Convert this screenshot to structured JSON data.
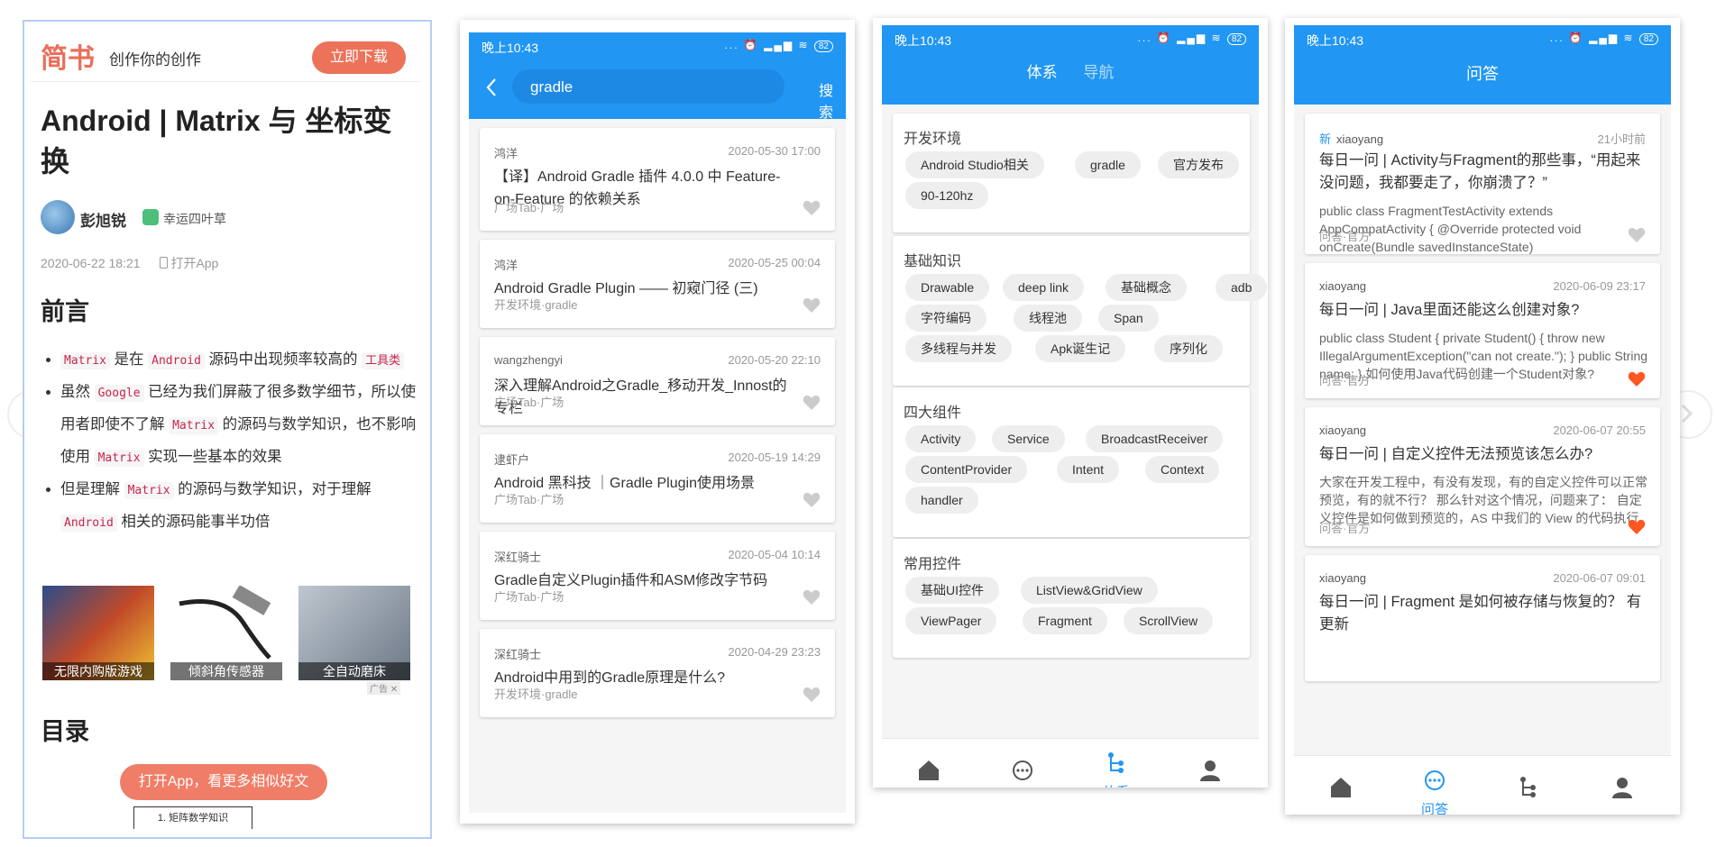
{
  "jianshu": {
    "logo": "简书",
    "slogan": "创作你的创作",
    "download_btn": "立即下载",
    "title": "Android | Matrix 与 坐标变换",
    "author": "彭旭锐",
    "badge": "幸运四叶草",
    "date": "2020-06-22 18:21",
    "open_app_meta": "打开App",
    "section_heading": "前言",
    "bullets": [
      [
        "Matrix",
        " 是在 ",
        "Android",
        " 源码中出现频率较高的 ",
        "工具类",
        ""
      ],
      [
        "",
        "虽然 ",
        "Google",
        " 已经为我们屏蔽了很多数学细节，所以使用者即使不了解 ",
        "Matrix",
        " 的源码与数学知识，也不影响使用 "
      ],
      [
        "",
        "但是理解 ",
        "Matrix",
        " 的源码与数学知识，对于理解 ",
        "Android",
        " 相关的源码能事半功倍"
      ]
    ],
    "bullet2_tail_code": "Matrix",
    "bullet2_tail_text": " 实现一些基本的效果",
    "ads": [
      "无限内购版游戏",
      "倾斜角传感器",
      "全自动磨床"
    ],
    "ad_mark": "广告 ✕",
    "toc_heading": "目录",
    "open_app_btn": "打开App，看更多相似好文",
    "toc_item": "1. 矩阵数学知识"
  },
  "status": {
    "time": "晚上10:43",
    "icons": "... ⏰ ▂▄▆ ≋",
    "battery": "82"
  },
  "search": {
    "query": "gradle",
    "button": "搜索",
    "results": [
      {
        "author": "鸿洋",
        "date": "2020-05-30 17:00",
        "title": "【译】Android Gradle 插件 4.0.0 中 Feature-on-Feature 的依赖关系",
        "tag": "广场Tab·广场"
      },
      {
        "author": "鸿洋",
        "date": "2020-05-25 00:04",
        "title": "Android Gradle Plugin —— 初窥门径 (三)",
        "tag": "开发环境·gradle"
      },
      {
        "author": "wangzhengyi",
        "date": "2020-05-20 22:10",
        "title": "深入理解Android之Gradle_移动开发_Innost的专栏",
        "tag": "广场Tab·广场"
      },
      {
        "author": "逮虾户",
        "date": "2020-05-19 14:29",
        "title": "Android 黑科技 ｜Gradle Plugin使用场景",
        "tag": "广场Tab·广场"
      },
      {
        "author": "深红骑士",
        "date": "2020-05-04 10:14",
        "title": "Gradle自定义Plugin插件和ASM修改字节码",
        "tag": "广场Tab·广场"
      },
      {
        "author": "深红骑士",
        "date": "2020-04-29 23:23",
        "title": "Android中用到的Gradle原理是什么?",
        "tag": "开发环境·gradle"
      }
    ]
  },
  "system": {
    "tabs": [
      "体系",
      "导航"
    ],
    "sections": [
      {
        "title": "开发环境",
        "chips": [
          "Android Studio相关",
          "gradle",
          "官方发布",
          "90-120hz"
        ]
      },
      {
        "title": "基础知识",
        "chips": [
          "Drawable",
          "deep link",
          "基础概念",
          "adb",
          "字符编码",
          "线程池",
          "Span",
          "多线程与并发",
          "Apk诞生记",
          "序列化"
        ]
      },
      {
        "title": "四大组件",
        "chips": [
          "Activity",
          "Service",
          "BroadcastReceiver",
          "ContentProvider",
          "Intent",
          "Context",
          "handler"
        ]
      },
      {
        "title": "常用控件",
        "chips": [
          "基础UI控件",
          "ListView&GridView",
          "ViewPager",
          "Fragment",
          "ScrollView"
        ]
      }
    ],
    "nav_active_label": "体系"
  },
  "qa": {
    "title": "问答",
    "nav_active_label": "问答",
    "new_mark": "新",
    "items": [
      {
        "author": "xiaoyang",
        "date": "21小时前",
        "title": "每日一问 | Activity与Fragment的那些事，“用起来没问题，我都要走了，你崩溃了？”",
        "desc": "public class FragmentTestActivity extends AppCompatActivity { @Override protected void onCreate(Bundle savedInstanceState)",
        "tag": "问答·官方",
        "liked": false
      },
      {
        "author": "xiaoyang",
        "date": "2020-06-09 23:17",
        "title": "每日一问 | Java里面还能这么创建对象?",
        "desc": "public class Student { private Student() { throw new IllegalArgumentException(\"can not create.\"); } public String name; } 如何使用Java代码创建一个Student对象?",
        "tag": "问答·官方",
        "liked": true
      },
      {
        "author": "xiaoyang",
        "date": "2020-06-07 20:55",
        "title": "每日一问 | 自定义控件无法预览该怎么办?",
        "desc": "大家在开发工程中，有没有发现，有的自定义控件可以正常预览，有的就不行？ 那么针对这个情况，问题来了： 自定义控件是如何做到预览的，AS 中我们的 View 的代码执行",
        "tag": "问答·官方",
        "liked": true
      },
      {
        "author": "xiaoyang",
        "date": "2020-06-07 09:01",
        "title": "每日一问 | Fragment 是如何被存储与恢复的？ 有更新",
        "desc": "",
        "tag": "",
        "liked": false
      }
    ]
  },
  "colors": {
    "primary": "#2196f3",
    "jianshu": "#ea6f5a",
    "heart_on": "#ff5722",
    "heart_off": "#cccccc"
  }
}
